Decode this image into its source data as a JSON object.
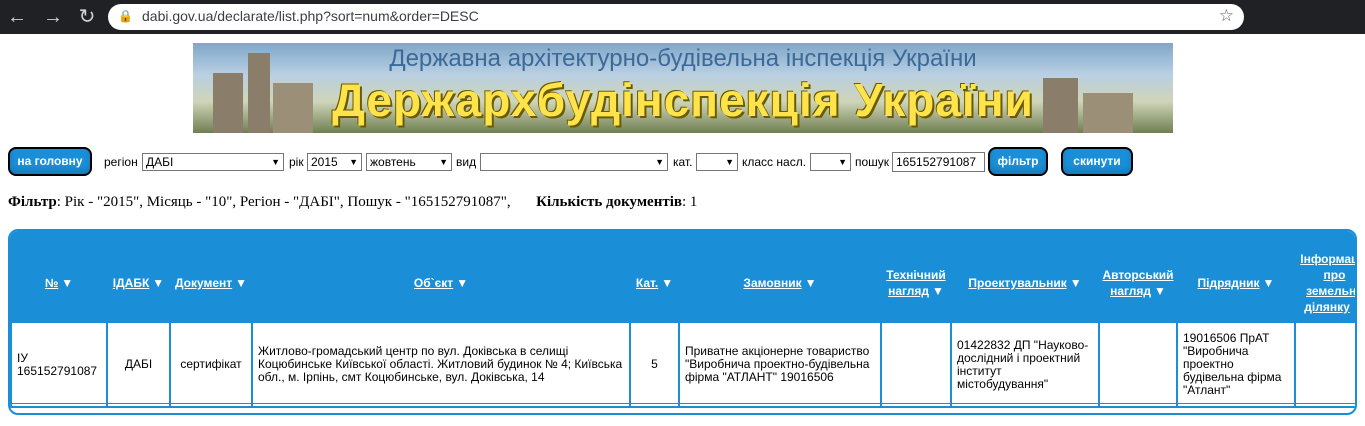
{
  "browser": {
    "url": "dabi.gov.ua/declarate/list.php?sort=num&order=DESC"
  },
  "banner": {
    "subtitle": "Державна архітектурно-будівельна інспекція України",
    "title": "Держархбудінспекція України"
  },
  "filters": {
    "home_button": "на головну",
    "region_label": "регіон",
    "region_value": "ДАБІ",
    "year_label": "рік",
    "year_value": "2015",
    "month_value": "жовтень",
    "kind_label": "вид",
    "kind_value": "",
    "cat_label": "кат.",
    "cat_value": "",
    "class_label": "класс насл.",
    "class_value": "",
    "search_label": "пошук",
    "search_value": "165152791087",
    "filter_button": "фільтр",
    "reset_button": "скинути"
  },
  "summary": {
    "filter_label": "Фільтр",
    "filter_text": ": Рік - \"2015\", Місяць - \"10\", Регіон - \"ДАБІ\", Пошук - \"165152791087\",",
    "count_label": "Кількість документів",
    "count_text": ": 1"
  },
  "table": {
    "headers": [
      "№",
      "ІДАБК",
      "Документ",
      "Об`єкт",
      "Кат.",
      "Замовник",
      "Технічний нагляд",
      "Проектувальник",
      "Авторський нагляд",
      "Підрядник",
      "Інформація про земельну ділянку"
    ],
    "rows": [
      [
        "ІУ 165152791087",
        "ДАБІ",
        "сертифікат",
        "Житлово-громадський центр по вул. Доківська в селищі Коцюбинське Київської області. Житловий будинок № 4; Київська обл., м. Ірпінь, смт Коцюбинське, вул. Доківська, 14",
        "5",
        "Приватне акціонерне товариство \"Виробнича проектно-будівельна фірма \"АТЛАНТ\" 19016506",
        "",
        "01422832 ДП \"Науково-дослідний і проектний інститут містобудування\"",
        "",
        "19016506 ПрАТ \"Виробнича проектно будівельна фірма \"Атлант\"",
        ""
      ]
    ]
  },
  "colors": {
    "accent": "#1a8fd8",
    "banner_text": "#ffe34a"
  }
}
